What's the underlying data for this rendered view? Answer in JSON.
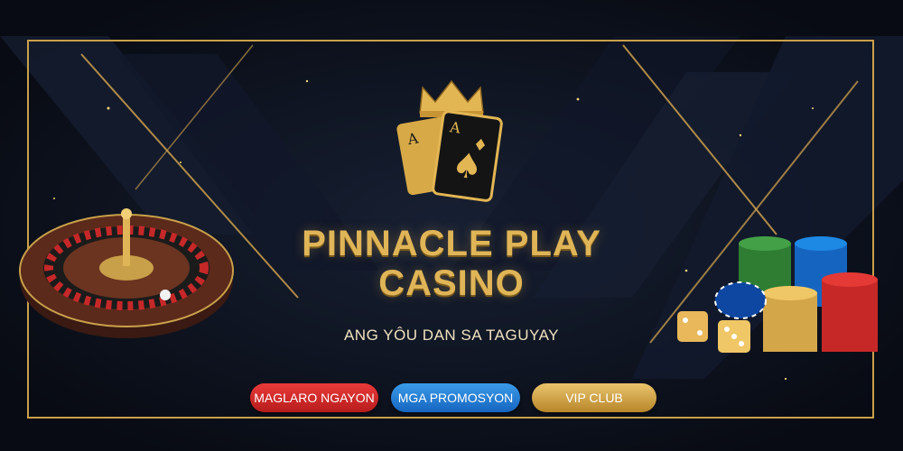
{
  "brand": {
    "title_line1": "PINNACLE PLAY",
    "title_line2": "CASINO",
    "tagline": "ANG YÔU DAN SA TAGUYAY"
  },
  "buttons": {
    "play_now": "MAGLARO NGAYON",
    "promotions": "MGA PROMOSYON",
    "vip": "VIP CLUB"
  },
  "colors": {
    "background": "#0b0f1a",
    "gold": "#e0b557",
    "red_button": "#d32f2f",
    "blue_button": "#1e88e5",
    "gold_button": "#d4a64a"
  },
  "icons": [
    "crown-icon",
    "playing-cards-icon",
    "roulette-wheel",
    "casino-chips",
    "dice"
  ]
}
